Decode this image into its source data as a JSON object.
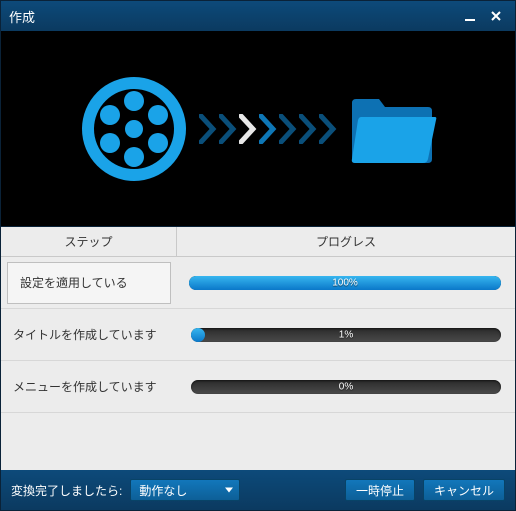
{
  "window": {
    "title": "作成"
  },
  "headers": {
    "step": "ステップ",
    "progress": "プログレス"
  },
  "steps": [
    {
      "label": "設定を適用している",
      "percent": 100,
      "pct_text": "100%",
      "active": true
    },
    {
      "label": "タイトルを作成しています",
      "percent": 1,
      "pct_text": "1%",
      "active": false
    },
    {
      "label": "メニューを作成しています",
      "percent": 0,
      "pct_text": "0%",
      "active": false
    }
  ],
  "footer": {
    "after_label": "変換完了しましたら:",
    "after_value": "動作なし",
    "pause": "一時停止",
    "cancel": "キャンセル"
  },
  "colors": {
    "accent": "#1aa3e8"
  }
}
